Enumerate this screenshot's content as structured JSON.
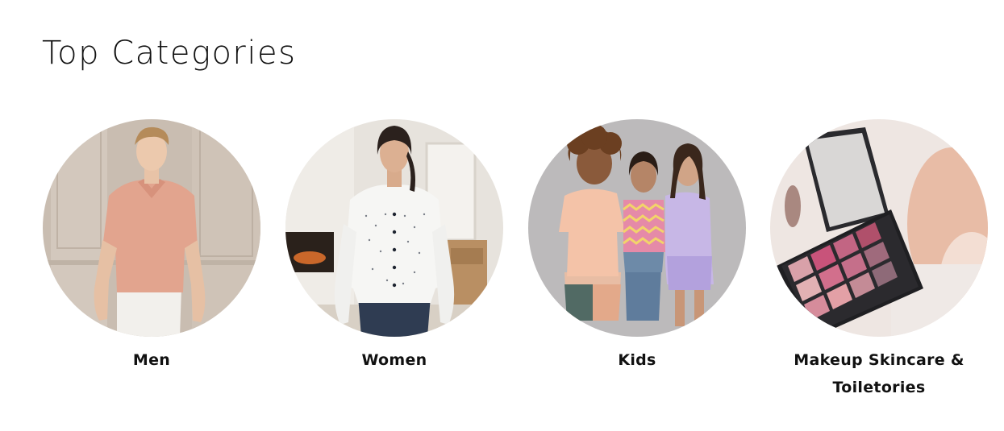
{
  "section": {
    "title": "Top Categories"
  },
  "categories": [
    {
      "label": "Men",
      "image": "man-pink-polo-photo"
    },
    {
      "label": "Women",
      "image": "woman-white-shirt-photo"
    },
    {
      "label": "Kids",
      "image": "three-kids-photo"
    },
    {
      "label": "Makeup Skincare & Toiletories",
      "image": "eyeshadow-palette-photo"
    }
  ]
}
